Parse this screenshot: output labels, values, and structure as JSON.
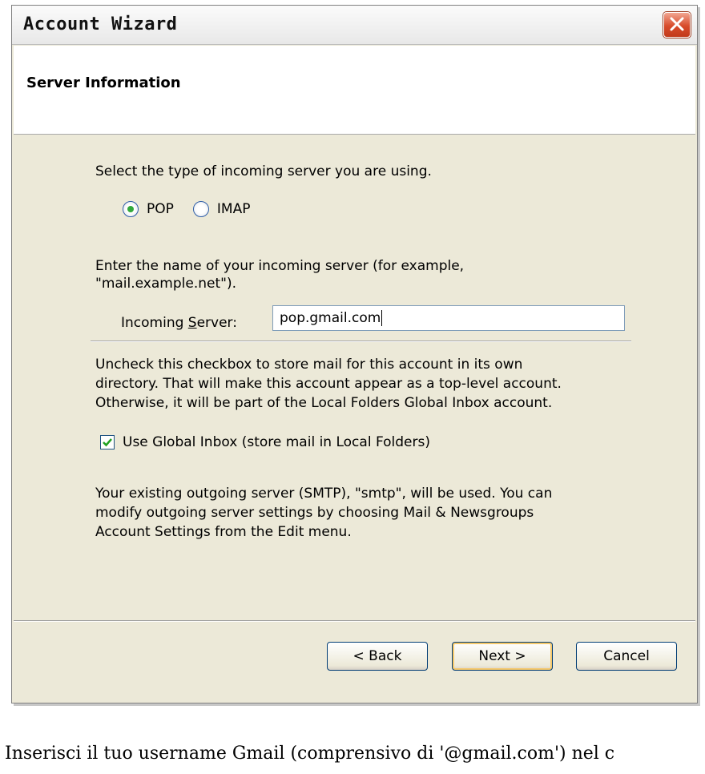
{
  "window": {
    "title": "Account Wizard"
  },
  "header": {
    "title": "Server Information"
  },
  "server_type": {
    "prompt": "Select the type of incoming server you are using.",
    "options": [
      {
        "label": "POP",
        "selected": true
      },
      {
        "label": "IMAP",
        "selected": false
      }
    ]
  },
  "incoming_server": {
    "prompt_line1": "Enter the name of your incoming server (for example,",
    "prompt_line2": "\"mail.example.net\").",
    "label_prefix": "Incoming ",
    "label_accel": "S",
    "label_suffix": "erver:",
    "value": "pop.gmail.com"
  },
  "global_inbox": {
    "info_line1": "Uncheck this checkbox to store mail for this account in its own",
    "info_line2": "directory. That will make this account appear as a top-level account.",
    "info_line3": "Otherwise, it will be part of the Local Folders Global Inbox account.",
    "checkbox_label": "Use Global Inbox (store mail in Local Folders)",
    "checked": true
  },
  "smtp_info": {
    "line1": "Your existing outgoing server (SMTP), \"smtp\", will be used. You can",
    "line2": "modify outgoing server settings by choosing Mail & Newsgroups",
    "line3": "Account Settings from the Edit menu."
  },
  "buttons": {
    "back": "< Back",
    "next": "Next >",
    "cancel": "Cancel"
  },
  "caption": "Inserisci il tuo username Gmail (comprensivo di '@gmail.com') nel c",
  "colors": {
    "radio_selected": "#31a93b",
    "checkbox_mark": "#21a121",
    "close_button": "#d84b2b"
  }
}
